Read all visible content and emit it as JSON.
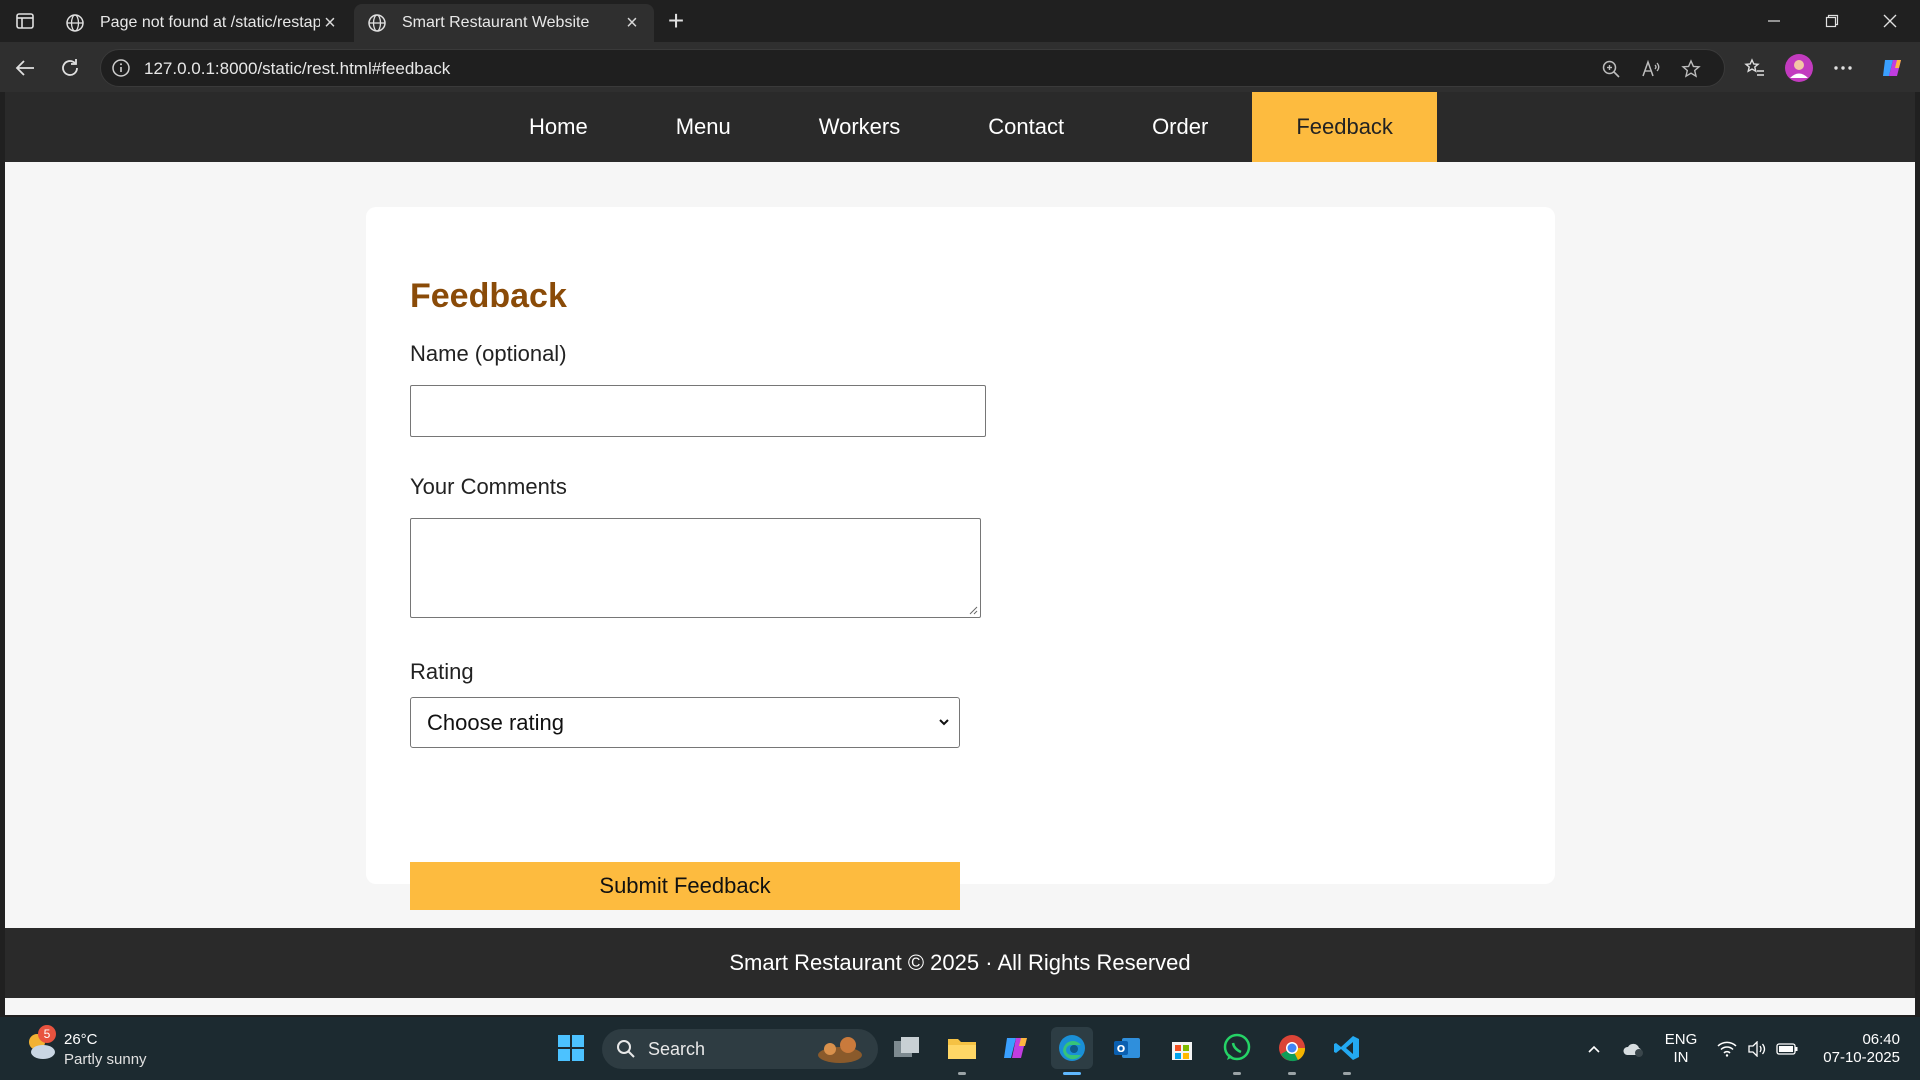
{
  "browser": {
    "tabs": [
      {
        "title": "Page not found at /static/restapp",
        "active": false
      },
      {
        "title": "Smart Restaurant Website",
        "active": true
      }
    ],
    "url": "127.0.0.1:8000/static/rest.html#feedback"
  },
  "site": {
    "nav": [
      "Home",
      "Menu",
      "Workers",
      "Contact",
      "Order",
      "Feedback"
    ],
    "active_nav": "Feedback",
    "accent_color": "#fdbb3f",
    "heading_color": "#8a4b08",
    "feedback": {
      "heading": "Feedback",
      "name_label": "Name (optional)",
      "name_value": "",
      "comments_label": "Your Comments",
      "comments_value": "",
      "rating_label": "Rating",
      "rating_selected": "Choose rating",
      "submit_label": "Submit Feedback"
    },
    "footer": "Smart Restaurant © 2025 · All Rights Reserved"
  },
  "taskbar": {
    "weather": {
      "badge": "5",
      "temp": "26°C",
      "condition": "Partly sunny"
    },
    "search_label": "Search",
    "lang": "ENG",
    "region": "IN",
    "time": "06:40",
    "date": "07-10-2025"
  }
}
